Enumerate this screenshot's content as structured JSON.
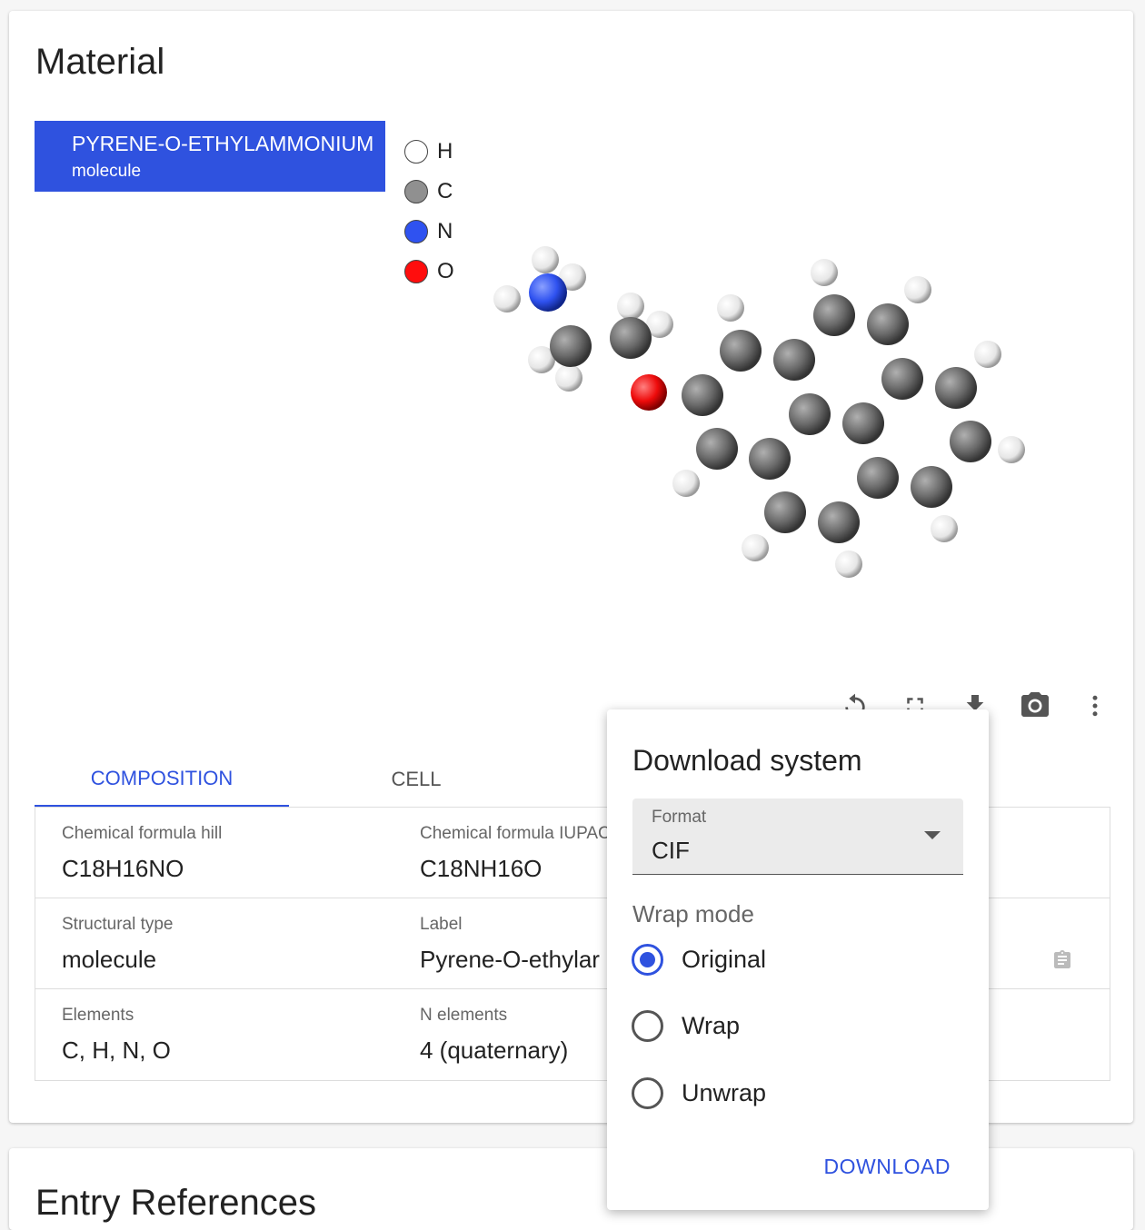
{
  "card": {
    "title": "Material"
  },
  "tree": {
    "name": "PYRENE-O-ETHYLAMMONIUM",
    "type": "molecule"
  },
  "legend": [
    {
      "symbol": "H",
      "color": "#ffffff"
    },
    {
      "symbol": "C",
      "color": "#909090"
    },
    {
      "symbol": "N",
      "color": "#2f52f0"
    },
    {
      "symbol": "O",
      "color": "#ff0d0d"
    }
  ],
  "toolbar": {
    "icons": [
      "reset-view-icon",
      "fullscreen-icon",
      "download-icon",
      "camera-icon",
      "more-vert-icon"
    ]
  },
  "tabs": [
    {
      "label": "COMPOSITION",
      "active": true
    },
    {
      "label": "CELL",
      "active": false
    }
  ],
  "properties": {
    "formula_hill": {
      "key": "Chemical formula hill",
      "value": "C18H16NO"
    },
    "formula_iupac": {
      "key": "Chemical formula IUPAC",
      "value": "C18NH16O"
    },
    "structural_type": {
      "key": "Structural type",
      "value": "molecule"
    },
    "label": {
      "key": "Label",
      "value": "Pyrene-O-ethylar"
    },
    "elements": {
      "key": "Elements",
      "value": "C, H, N, O"
    },
    "n_elements": {
      "key": "N elements",
      "value": "4 (quaternary)"
    }
  },
  "popover": {
    "title": "Download system",
    "format_label": "Format",
    "format_value": "CIF",
    "wrap_label": "Wrap mode",
    "options": [
      "Original",
      "Wrap",
      "Unwrap"
    ],
    "selected": "Original",
    "download_label": "DOWNLOAD"
  },
  "card2": {
    "title": "Entry References"
  },
  "colors": {
    "accent": "#2f52df"
  }
}
